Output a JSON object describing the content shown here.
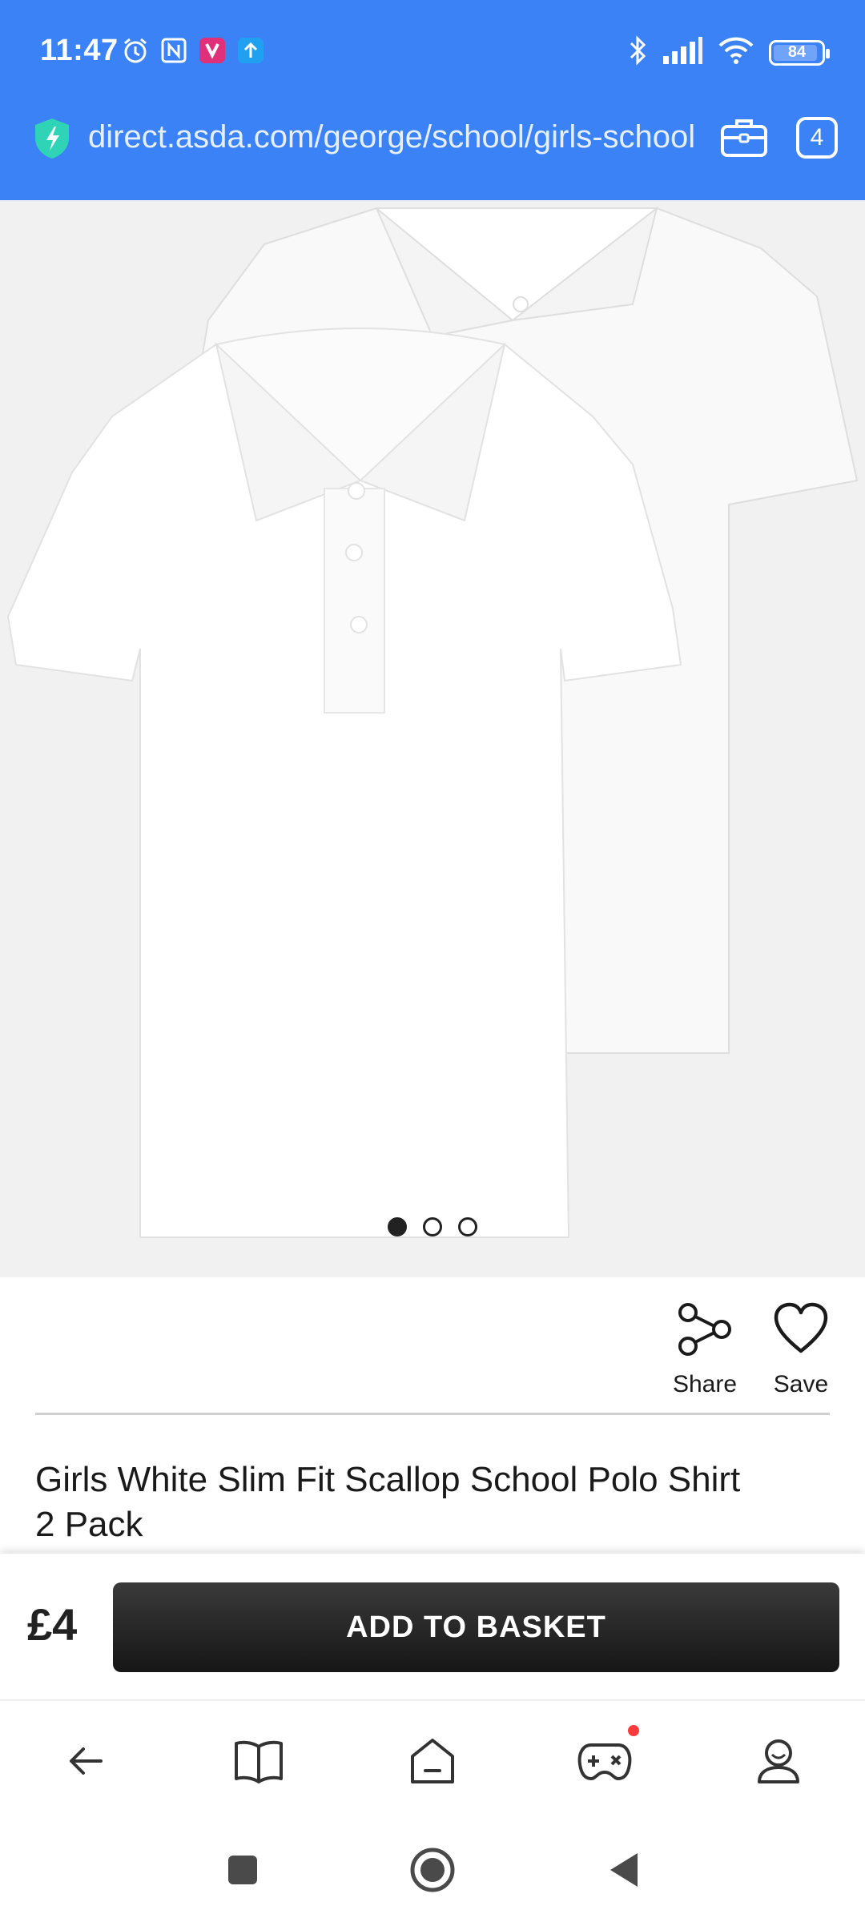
{
  "status_bar": {
    "time": "11:47",
    "battery_level": "84",
    "left_icons": [
      "alarm-icon",
      "nfc-icon",
      "app-notification-icon",
      "upload-icon"
    ],
    "right_icons": [
      "bluetooth-icon",
      "signal-icon",
      "wifi-icon",
      "battery-icon"
    ]
  },
  "browser": {
    "url": "direct.asda.com/george/school/girls-school",
    "tab_count": "4",
    "theme_color": "#3a82f6"
  },
  "product": {
    "image_alt": "Girls white polo shirts",
    "carousel": {
      "total": 3,
      "active_index": 0
    },
    "title": "Girls White Slim Fit Scallop School Polo Shirt 2 Pack",
    "price": "£4"
  },
  "actions": {
    "share_label": "Share",
    "save_label": "Save"
  },
  "basket": {
    "button_label": "ADD TO BASKET"
  },
  "bottom_nav": {
    "items": [
      "back-icon",
      "book-icon",
      "home-icon",
      "games-icon",
      "profile-icon"
    ]
  },
  "system_nav": {
    "items": [
      "recents-icon",
      "home-icon",
      "back-icon"
    ]
  }
}
